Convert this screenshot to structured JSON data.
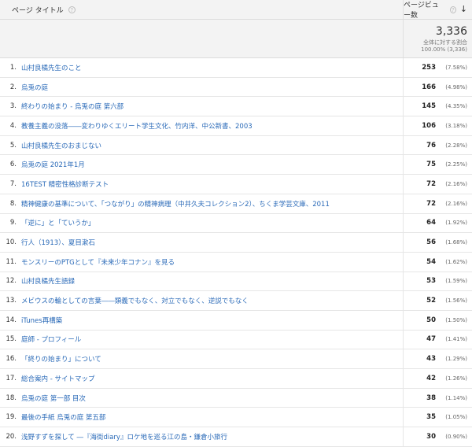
{
  "header": {
    "title_col": "ページ タイトル",
    "views_col": "ページビュー数"
  },
  "summary": {
    "total": "3,336",
    "label": "全体に対する割合",
    "pct": "100.00% (3,336)"
  },
  "rows": [
    {
      "num": "1.",
      "title": "山村良橘先生のこと",
      "views": "253",
      "pct": "(7.58%)"
    },
    {
      "num": "2.",
      "title": "烏兎の庭",
      "views": "166",
      "pct": "(4.98%)"
    },
    {
      "num": "3.",
      "title": "終わりの始まり - 烏兎の庭 第六部",
      "views": "145",
      "pct": "(4.35%)"
    },
    {
      "num": "4.",
      "title": "教養主義の没落――変わりゆくエリート学生文化、竹内洋、中公新書、2003",
      "views": "106",
      "pct": "(3.18%)"
    },
    {
      "num": "5.",
      "title": "山村良橘先生のおまじない",
      "views": "76",
      "pct": "(2.28%)"
    },
    {
      "num": "6.",
      "title": "烏兎の庭 2021年1月",
      "views": "75",
      "pct": "(2.25%)"
    },
    {
      "num": "7.",
      "title": "16TEST 精密性格診断テスト",
      "views": "72",
      "pct": "(2.16%)"
    },
    {
      "num": "8.",
      "title": "精神健康の基準について、「つながり」の精神病理（中井久夫コレクション2）、ちくま学芸文庫、2011",
      "views": "72",
      "pct": "(2.16%)"
    },
    {
      "num": "9.",
      "title": "「逆に」と「ていうか」",
      "views": "64",
      "pct": "(1.92%)"
    },
    {
      "num": "10.",
      "title": "行人（1913）、夏目漱石",
      "views": "56",
      "pct": "(1.68%)"
    },
    {
      "num": "11.",
      "title": "モンスリーのPTGとして『未来少年コナン』を見る",
      "views": "54",
      "pct": "(1.62%)"
    },
    {
      "num": "12.",
      "title": "山村良橘先生語録",
      "views": "53",
      "pct": "(1.59%)"
    },
    {
      "num": "13.",
      "title": "メビウスの輪としての言葉――類義でもなく、対立でもなく、逆説でもなく",
      "views": "52",
      "pct": "(1.56%)"
    },
    {
      "num": "14.",
      "title": "iTunes再構築",
      "views": "50",
      "pct": "(1.50%)"
    },
    {
      "num": "15.",
      "title": "庭師 - プロフィール",
      "views": "47",
      "pct": "(1.41%)"
    },
    {
      "num": "16.",
      "title": "「終りの始まり」について",
      "views": "43",
      "pct": "(1.29%)"
    },
    {
      "num": "17.",
      "title": "総合案内 - サイトマップ",
      "views": "42",
      "pct": "(1.26%)"
    },
    {
      "num": "18.",
      "title": "烏兎の庭 第一部 目次",
      "views": "38",
      "pct": "(1.14%)"
    },
    {
      "num": "19.",
      "title": "最後の手紙 烏兎の庭 第五部",
      "views": "35",
      "pct": "(1.05%)"
    },
    {
      "num": "20.",
      "title": "浅野すずを探して ―『海街diary』ロケ地を巡る江の島・鎌倉小旅行",
      "views": "30",
      "pct": "(0.90%)"
    }
  ]
}
